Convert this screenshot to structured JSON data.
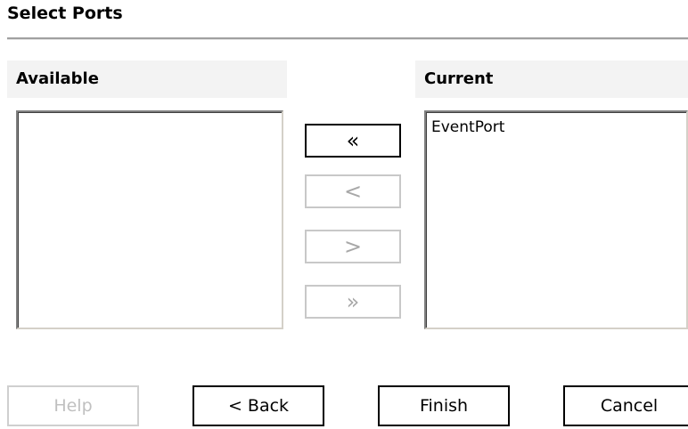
{
  "dialog": {
    "title": "Select Ports"
  },
  "available": {
    "header": "Available",
    "items": []
  },
  "current": {
    "header": "Current",
    "items": [
      "EventPort"
    ]
  },
  "move_buttons": {
    "remove_all": {
      "label": "«",
      "enabled": true
    },
    "remove": {
      "label": "<",
      "enabled": false
    },
    "add": {
      "label": ">",
      "enabled": false
    },
    "add_all": {
      "label": "»",
      "enabled": false
    }
  },
  "footer": {
    "help": {
      "label": "Help",
      "enabled": false
    },
    "back": {
      "label": "< Back",
      "enabled": true
    },
    "finish": {
      "label": "Finish",
      "enabled": true
    },
    "cancel": {
      "label": "Cancel",
      "enabled": true
    }
  }
}
